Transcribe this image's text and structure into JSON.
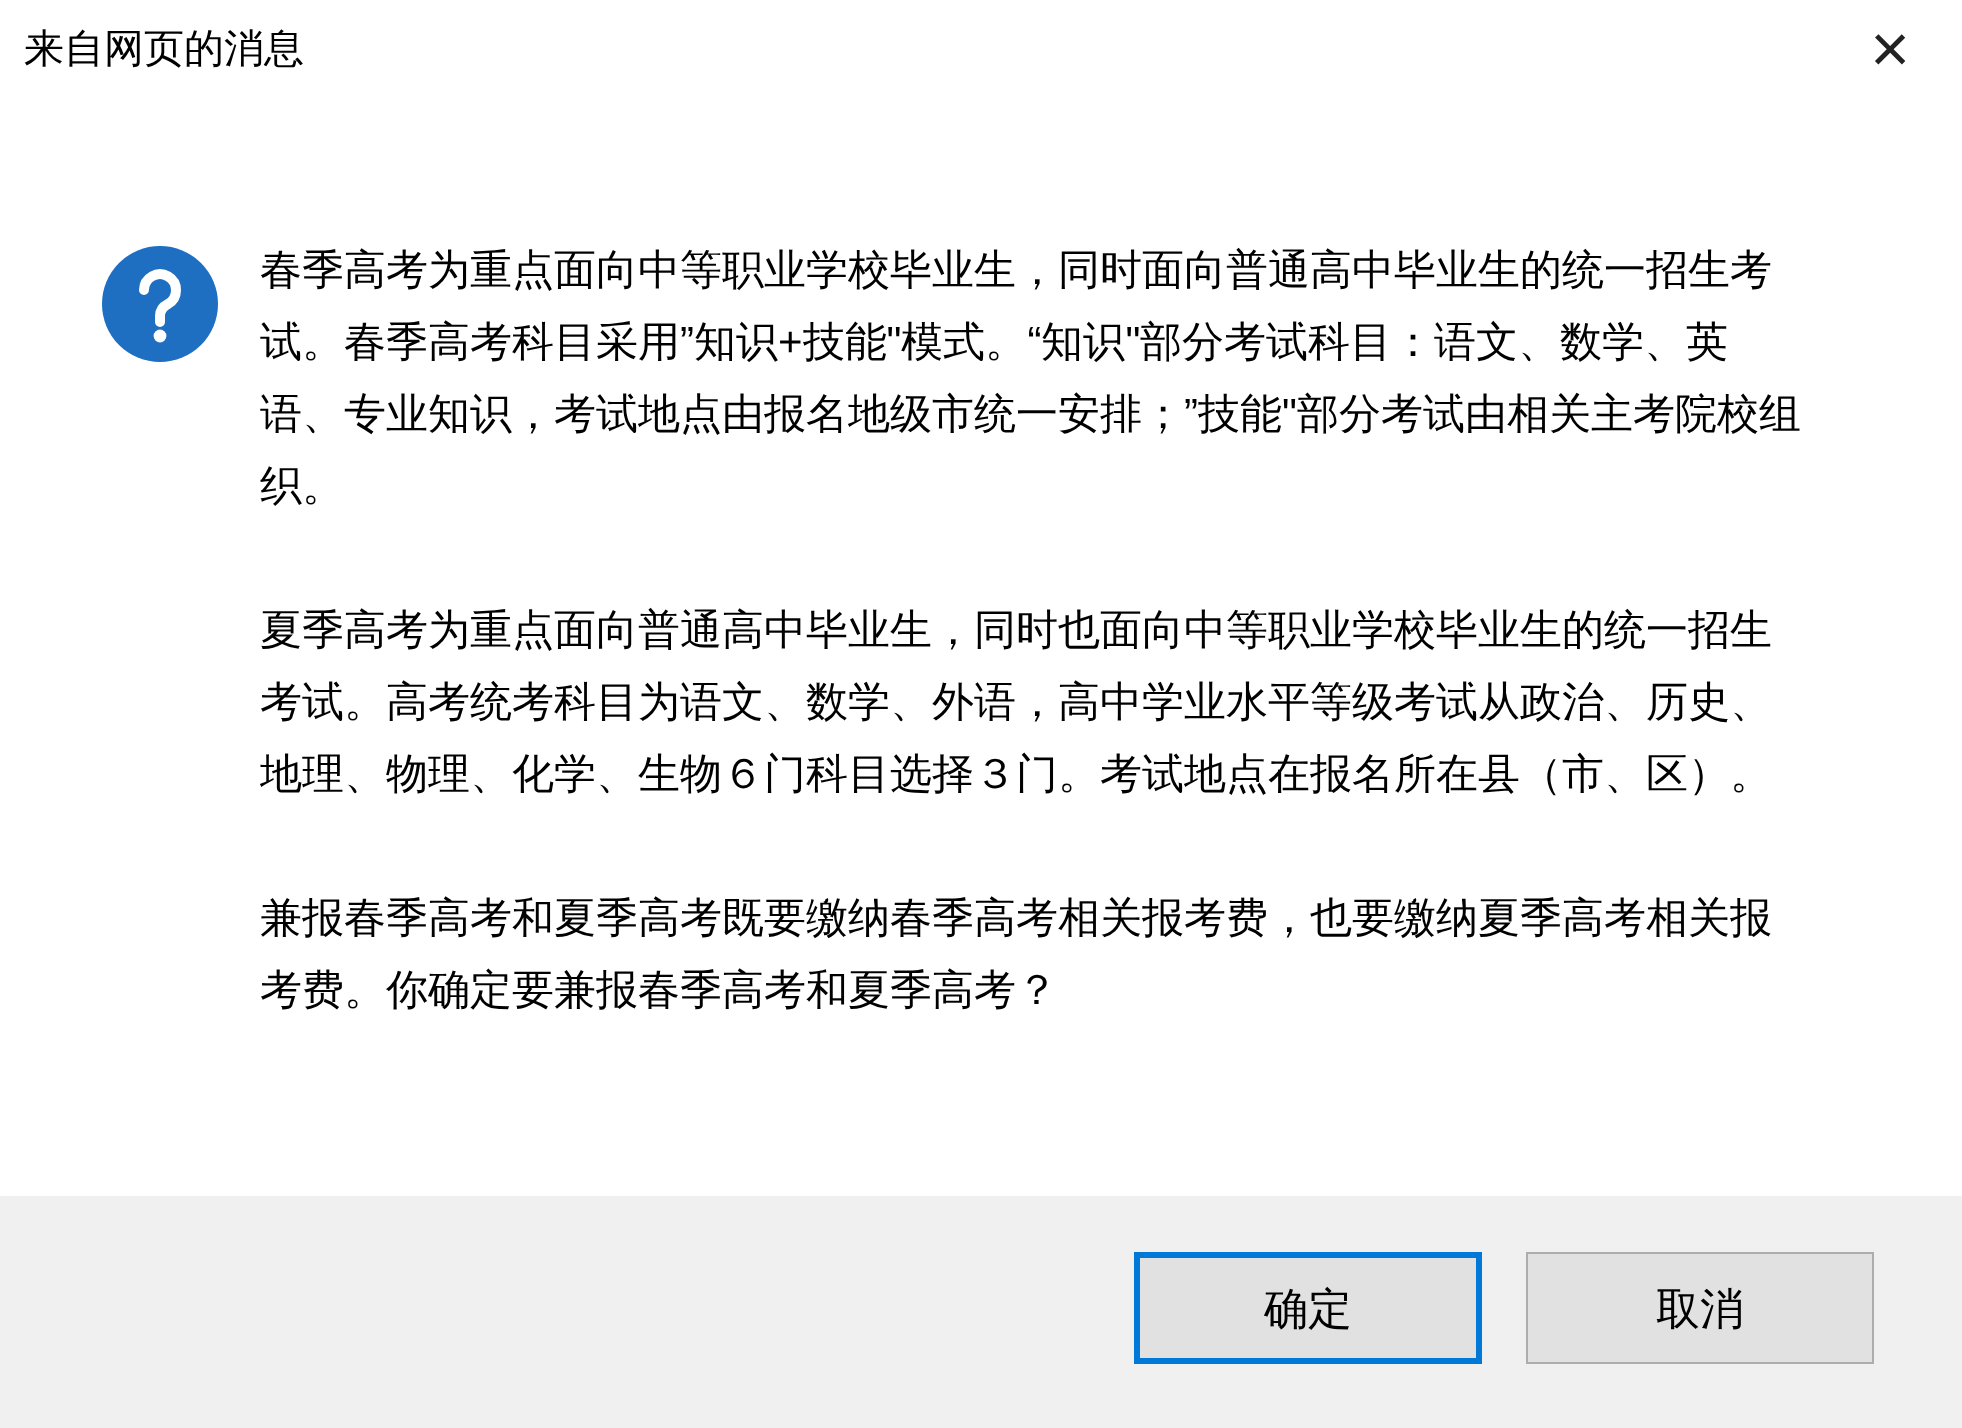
{
  "window": {
    "title": "来自网页的消息",
    "close": "×"
  },
  "message": {
    "paragraphs": [
      "春季高考为重点面向中等职业学校毕业生，同时面向普通高中毕业生的统一招生考试。春季高考科目采用”知识+技能\"模式。“知识\"部分考试科目：语文、数学、英语、专业知识，考试地点由报名地级市统一安排；”技能\"部分考试由相关主考院校组织。",
      "夏季高考为重点面向普通高中毕业生，同时也面向中等职业学校毕业生的统一招生考试。高考统考科目为语文、数学、外语，高中学业水平等级考试从政治、历史、地理、物理、化学、生物６门科目选择３门。考试地点在报名所在县（市、区）。",
      "兼报春季高考和夏季高考既要缴纳春季高考相关报考费，也要缴纳夏季高考相关报考费。你确定要兼报春季高考和夏季高考？"
    ]
  },
  "buttons": [
    {
      "label": "确定",
      "selected": true
    },
    {
      "label": "取消",
      "selected": false
    }
  ]
}
